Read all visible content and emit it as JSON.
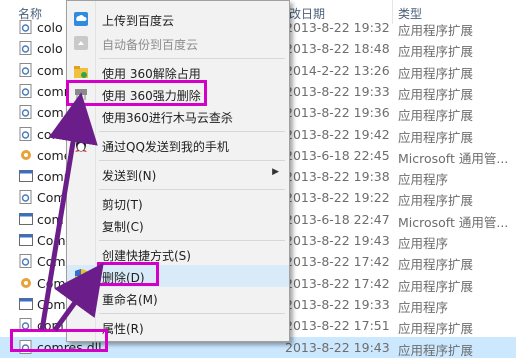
{
  "header": {
    "name_col": "名称",
    "date_col": "改日期",
    "type_col": "类型"
  },
  "files": [
    {
      "name": "colo",
      "date": "2013-8-22 19:32",
      "type": "应用程序扩展",
      "icon": "dll-icon"
    },
    {
      "name": "colo",
      "date": "2013-8-22 18:48",
      "type": "应用程序扩展",
      "icon": "dll-icon"
    },
    {
      "name": "com",
      "date": "2014-2-22 13:26",
      "type": "应用程序扩展",
      "icon": "dll-icon"
    },
    {
      "name": "comre",
      "date": "2013-8-22 19:33",
      "type": "应用程序扩展",
      "icon": "dll-icon"
    },
    {
      "name": "com",
      "date": "2013-8-22 19:36",
      "type": "应用程序扩展",
      "icon": "dll-icon"
    },
    {
      "name": "com",
      "date": "2013-8-22 19:42",
      "type": "应用程序扩展",
      "icon": "dll-icon"
    },
    {
      "name": "come",
      "date": "2013-6-18 22:45",
      "type": "Microsoft 通用管...",
      "icon": "gear-icon"
    },
    {
      "name": "comp",
      "date": "2013-8-22 19:38",
      "type": "应用程序",
      "icon": "app-icon"
    },
    {
      "name": "Comp",
      "date": "2013-8-22 19:22",
      "type": "应用程序扩展",
      "icon": "dll-icon"
    },
    {
      "name": "com",
      "date": "2013-6-18 22:47",
      "type": "Microsoft 通用管...",
      "icon": "app-icon"
    },
    {
      "name": "Com",
      "date": "2013-8-22 19:43",
      "type": "应用程序",
      "icon": "app-icon"
    },
    {
      "name": "Com",
      "date": "2013-8-22 17:42",
      "type": "应用程序扩展",
      "icon": "dll-icon"
    },
    {
      "name": "Com",
      "date": "2013-8-22 17:42",
      "type": "应用程序扩展",
      "icon": "gear-icon"
    },
    {
      "name": "Com",
      "date": "2013-8-22 19:33",
      "type": "应用程序",
      "icon": "app-icon"
    },
    {
      "name": "com",
      "date": "2013-8-22 17:51",
      "type": "应用程序扩展",
      "icon": "dll-icon"
    },
    {
      "name": "comres.dll",
      "date": "2013-8-22 19:43",
      "type": "应用程序扩展",
      "icon": "dll-icon"
    }
  ],
  "menu": {
    "upload": "上传到百度云",
    "auto_backup": "自动备份到百度云",
    "unlock360": "使用 360解除占用",
    "force_delete360": "使用 360强力删除",
    "trojan_scan360": "使用360进行木马云查杀",
    "send_qq": "通过QQ发送到我的手机",
    "send_to": "发送到(N)",
    "cut": "剪切(T)",
    "copy": "复制(C)",
    "create_shortcut": "创建快捷方式(S)",
    "delete": "删除(D)",
    "rename": "重命名(M)",
    "properties": "属性(R)"
  },
  "colors": {
    "highlight_box": "#d400c8",
    "arrow": "#6b1e8a",
    "selected_row": "#cce8ff"
  }
}
